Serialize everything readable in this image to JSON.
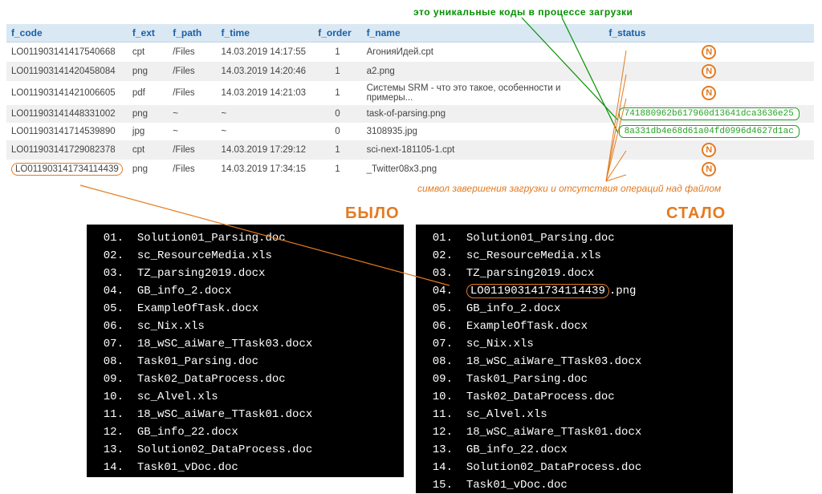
{
  "annotations": {
    "top": "это уникальные коды в процессе загрузки",
    "mid": "символ завершения загрузки и отсутствия операций над файлом",
    "was": "БЫЛО",
    "now": "СТАЛО"
  },
  "table": {
    "headers": {
      "code": "f_code",
      "ext": "f_ext",
      "path": "f_path",
      "time": "f_time",
      "order": "f_order",
      "name": "f_name",
      "status": "f_status"
    },
    "rows": [
      {
        "code": "LO011903141417540668",
        "ext": "cpt",
        "path": "/Files",
        "time": "14.03.2019 14:17:55",
        "order": "1",
        "name": "АгонияИдей.cpt",
        "status_type": "N",
        "status_val": "N"
      },
      {
        "code": "LO011903141420458084",
        "ext": "png",
        "path": "/Files",
        "time": "14.03.2019 14:20:46",
        "order": "1",
        "name": "a2.png",
        "status_type": "N",
        "status_val": "N"
      },
      {
        "code": "LO011903141421006605",
        "ext": "pdf",
        "path": "/Files",
        "time": "14.03.2019 14:21:03",
        "order": "1",
        "name": "Системы SRM - что это такое, особенности и примеры...",
        "status_type": "N",
        "status_val": "N"
      },
      {
        "code": "LO011903141448331002",
        "ext": "png",
        "path": "~",
        "time": "~",
        "order": "0",
        "name": "task-of-parsing.png",
        "status_type": "hash",
        "status_val": "741880962b617960d13641dca3636e25"
      },
      {
        "code": "LO011903141714539890",
        "ext": "jpg",
        "path": "~",
        "time": "~",
        "order": "0",
        "name": "3108935.jpg",
        "status_type": "hash",
        "status_val": "8a331db4e68d61a04fd0996d4627d1ac"
      },
      {
        "code": "LO011903141729082378",
        "ext": "cpt",
        "path": "/Files",
        "time": "14.03.2019 17:29:12",
        "order": "1",
        "name": "sci-next-181105-1.cpt",
        "status_type": "N",
        "status_val": "N"
      },
      {
        "code": "LO011903141734114439",
        "ext": "png",
        "path": "/Files",
        "time": "14.03.2019 17:34:15",
        "order": "1",
        "name": "_Twitter08x3.png",
        "status_type": "N",
        "status_val": "N",
        "code_circled": true
      }
    ]
  },
  "terminals": {
    "was": [
      {
        "n": "01.",
        "f": "Solution01_Parsing.doc"
      },
      {
        "n": "02.",
        "f": "sc_ResourceMedia.xls"
      },
      {
        "n": "03.",
        "f": "TZ_parsing2019.docx"
      },
      {
        "n": "04.",
        "f": "GB_info_2.docx"
      },
      {
        "n": "05.",
        "f": "ExampleOfTask.docx"
      },
      {
        "n": "06.",
        "f": "sc_Nix.xls"
      },
      {
        "n": "07.",
        "f": "18_wSC_aiWare_TTask03.docx"
      },
      {
        "n": "08.",
        "f": "Task01_Parsing.doc"
      },
      {
        "n": "09.",
        "f": "Task02_DataProcess.doc"
      },
      {
        "n": "10.",
        "f": "sc_Alvel.xls"
      },
      {
        "n": "11.",
        "f": "18_wSC_aiWare_TTask01.docx"
      },
      {
        "n": "12.",
        "f": "GB_info_22.docx"
      },
      {
        "n": "13.",
        "f": "Solution02_DataProcess.doc"
      },
      {
        "n": "14.",
        "f": "Task01_vDoc.doc"
      }
    ],
    "now": [
      {
        "n": "01.",
        "f": "Solution01_Parsing.doc"
      },
      {
        "n": "02.",
        "f": "sc_ResourceMedia.xls"
      },
      {
        "n": "03.",
        "f": "TZ_parsing2019.docx"
      },
      {
        "n": "04.",
        "f": "LO011903141734114439",
        "suffix": ".png",
        "circled": true
      },
      {
        "n": "05.",
        "f": "GB_info_2.docx"
      },
      {
        "n": "06.",
        "f": "ExampleOfTask.docx"
      },
      {
        "n": "07.",
        "f": "sc_Nix.xls"
      },
      {
        "n": "08.",
        "f": "18_wSC_aiWare_TTask03.docx"
      },
      {
        "n": "09.",
        "f": "Task01_Parsing.doc"
      },
      {
        "n": "10.",
        "f": "Task02_DataProcess.doc"
      },
      {
        "n": "11.",
        "f": "sc_Alvel.xls"
      },
      {
        "n": "12.",
        "f": "18_wSC_aiWare_TTask01.docx"
      },
      {
        "n": "13.",
        "f": "GB_info_22.docx"
      },
      {
        "n": "14.",
        "f": "Solution02_DataProcess.doc"
      },
      {
        "n": "15.",
        "f": "Task01_vDoc.doc"
      }
    ]
  }
}
